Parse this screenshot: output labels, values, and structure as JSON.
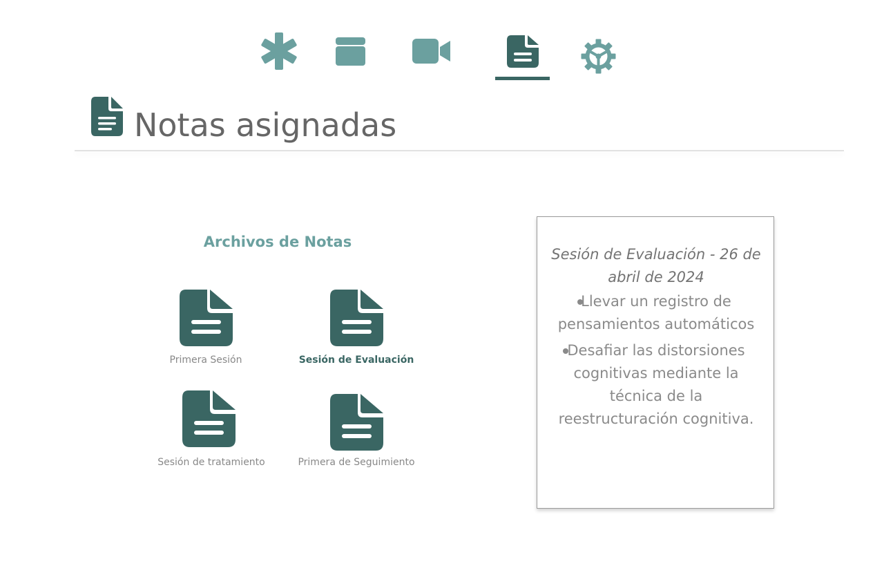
{
  "nav": {
    "items": [
      {
        "icon": "asterisk-icon",
        "label": "Inicio"
      },
      {
        "icon": "calendar-icon",
        "label": "Calendario"
      },
      {
        "icon": "video-camera-icon",
        "label": "Videollamada"
      },
      {
        "icon": "document-icon",
        "label": "Notas",
        "active": true
      },
      {
        "icon": "gear-icon",
        "label": "Configuración"
      }
    ]
  },
  "header": {
    "icon": "document-icon",
    "title": "Notas asignadas"
  },
  "files": {
    "heading": "Archivos de Notas",
    "items": [
      {
        "label": "Primera Sesión",
        "selected": false
      },
      {
        "label": "Sesión de Evaluación",
        "selected": true
      },
      {
        "label": "Sesión de tratamiento",
        "selected": false
      },
      {
        "label": "Primera de Seguimiento",
        "selected": false
      }
    ]
  },
  "note": {
    "title": "Sesión de Evaluación - 26 de abril de 2024",
    "items": [
      "Llevar un registro de pensamientos automáticos",
      "Desafiar las distorsiones cognitivas mediante la técnica de la reestructuración cognitiva."
    ]
  },
  "colors": {
    "accent_dark": "#3a6663",
    "accent_light": "#6ba09f",
    "text_gray": "#666666"
  }
}
